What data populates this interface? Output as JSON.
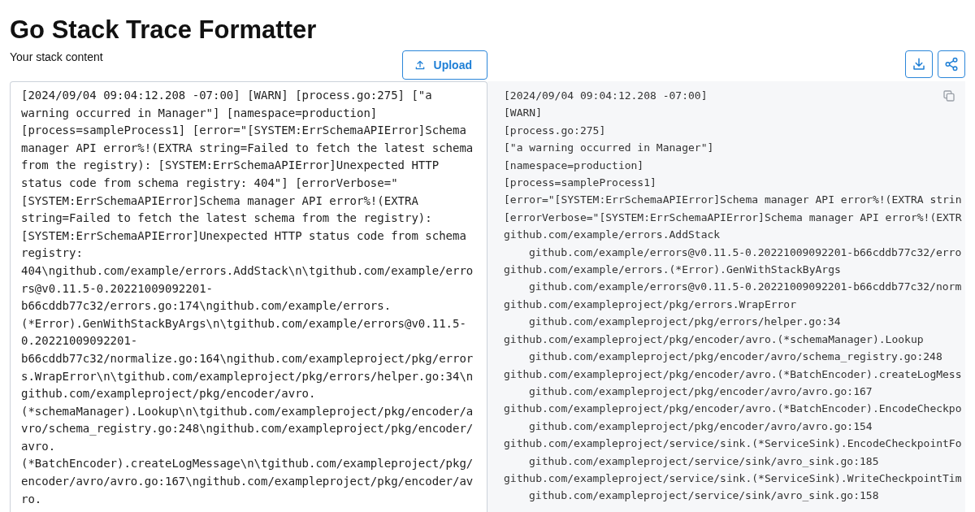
{
  "title": "Go Stack Trace Formatter",
  "input": {
    "label": "Your stack content",
    "upload_button": "Upload",
    "value": "[2024/09/04 09:04:12.208 -07:00] [WARN] [process.go:275] [\"a warning occurred in Manager\"] [namespace=production] [process=sampleProcess1] [error=\"[SYSTEM:ErrSchemaAPIError]Schema manager API error%!(EXTRA string=Failed to fetch the latest schema from the registry): [SYSTEM:ErrSchemaAPIError]Unexpected HTTP status code from schema registry: 404\"] [errorVerbose=\"[SYSTEM:ErrSchemaAPIError]Schema manager API error%!(EXTRA string=Failed to fetch the latest schema from the registry): [SYSTEM:ErrSchemaAPIError]Unexpected HTTP status code from schema registry: 404\\ngithub.com/example/errors.AddStack\\n\\tgithub.com/example/errors@v0.11.5-0.20221009092201-b66cddb77c32/errors.go:174\\ngithub.com/example/errors.(*Error).GenWithStackByArgs\\n\\tgithub.com/example/errors@v0.11.5-0.20221009092201-b66cddb77c32/normalize.go:164\\ngithub.com/exampleproject/pkg/errors.WrapError\\n\\tgithub.com/exampleproject/pkg/errors/helper.go:34\\ngithub.com/exampleproject/pkg/encoder/avro.(*schemaManager).Lookup\\n\\tgithub.com/exampleproject/pkg/encoder/avro/schema_registry.go:248\\ngithub.com/exampleproject/pkg/encoder/avro.(*BatchEncoder).createLogMessage\\n\\tgithub.com/exampleproject/pkg/encoder/avro/avro.go:167\\ngithub.com/exampleproject/pkg/encoder/avro."
  },
  "output": {
    "lines": [
      {
        "kind": "field",
        "text": "[2024/09/04 09:04:12.208 -07:00]"
      },
      {
        "kind": "field",
        "text": "[WARN]"
      },
      {
        "kind": "field",
        "text": "[process.go:275]"
      },
      {
        "kind": "field",
        "text": "[\"a warning occurred in Manager\"]"
      },
      {
        "kind": "field",
        "text": "[namespace=production]"
      },
      {
        "kind": "field",
        "text": "[process=sampleProcess1]"
      },
      {
        "kind": "field",
        "text": "[error=\"[SYSTEM:ErrSchemaAPIError]Schema manager API error%!(EXTRA strin"
      },
      {
        "kind": "field",
        "text": "[errorVerbose=\"[SYSTEM:ErrSchemaAPIError]Schema manager API error%!(EXTR"
      },
      {
        "kind": "function",
        "text": "github.com/example/errors.AddStack"
      },
      {
        "kind": "location",
        "text": "github.com/example/errors@v0.11.5-0.20221009092201-b66cddb77c32/erro"
      },
      {
        "kind": "function",
        "text": "github.com/example/errors.(*Error).GenWithStackByArgs"
      },
      {
        "kind": "location",
        "text": "github.com/example/errors@v0.11.5-0.20221009092201-b66cddb77c32/norm"
      },
      {
        "kind": "function",
        "text": "github.com/exampleproject/pkg/errors.WrapError"
      },
      {
        "kind": "location",
        "text": "github.com/exampleproject/pkg/errors/helper.go:34"
      },
      {
        "kind": "function",
        "text": "github.com/exampleproject/pkg/encoder/avro.(*schemaManager).Lookup"
      },
      {
        "kind": "location",
        "text": "github.com/exampleproject/pkg/encoder/avro/schema_registry.go:248"
      },
      {
        "kind": "function",
        "text": "github.com/exampleproject/pkg/encoder/avro.(*BatchEncoder).createLogMess"
      },
      {
        "kind": "location",
        "text": "github.com/exampleproject/pkg/encoder/avro/avro.go:167"
      },
      {
        "kind": "function",
        "text": "github.com/exampleproject/pkg/encoder/avro.(*BatchEncoder).EncodeCheckpo"
      },
      {
        "kind": "location",
        "text": "github.com/exampleproject/pkg/encoder/avro/avro.go:154"
      },
      {
        "kind": "function",
        "text": "github.com/exampleproject/service/sink.(*ServiceSink).EncodeCheckpointFo"
      },
      {
        "kind": "location",
        "text": "github.com/exampleproject/service/sink/avro_sink.go:185"
      },
      {
        "kind": "function",
        "text": "github.com/exampleproject/service/sink.(*ServiceSink).WriteCheckpointTim"
      },
      {
        "kind": "location",
        "text": "github.com/exampleproject/service/sink/avro_sink.go:158"
      }
    ]
  }
}
